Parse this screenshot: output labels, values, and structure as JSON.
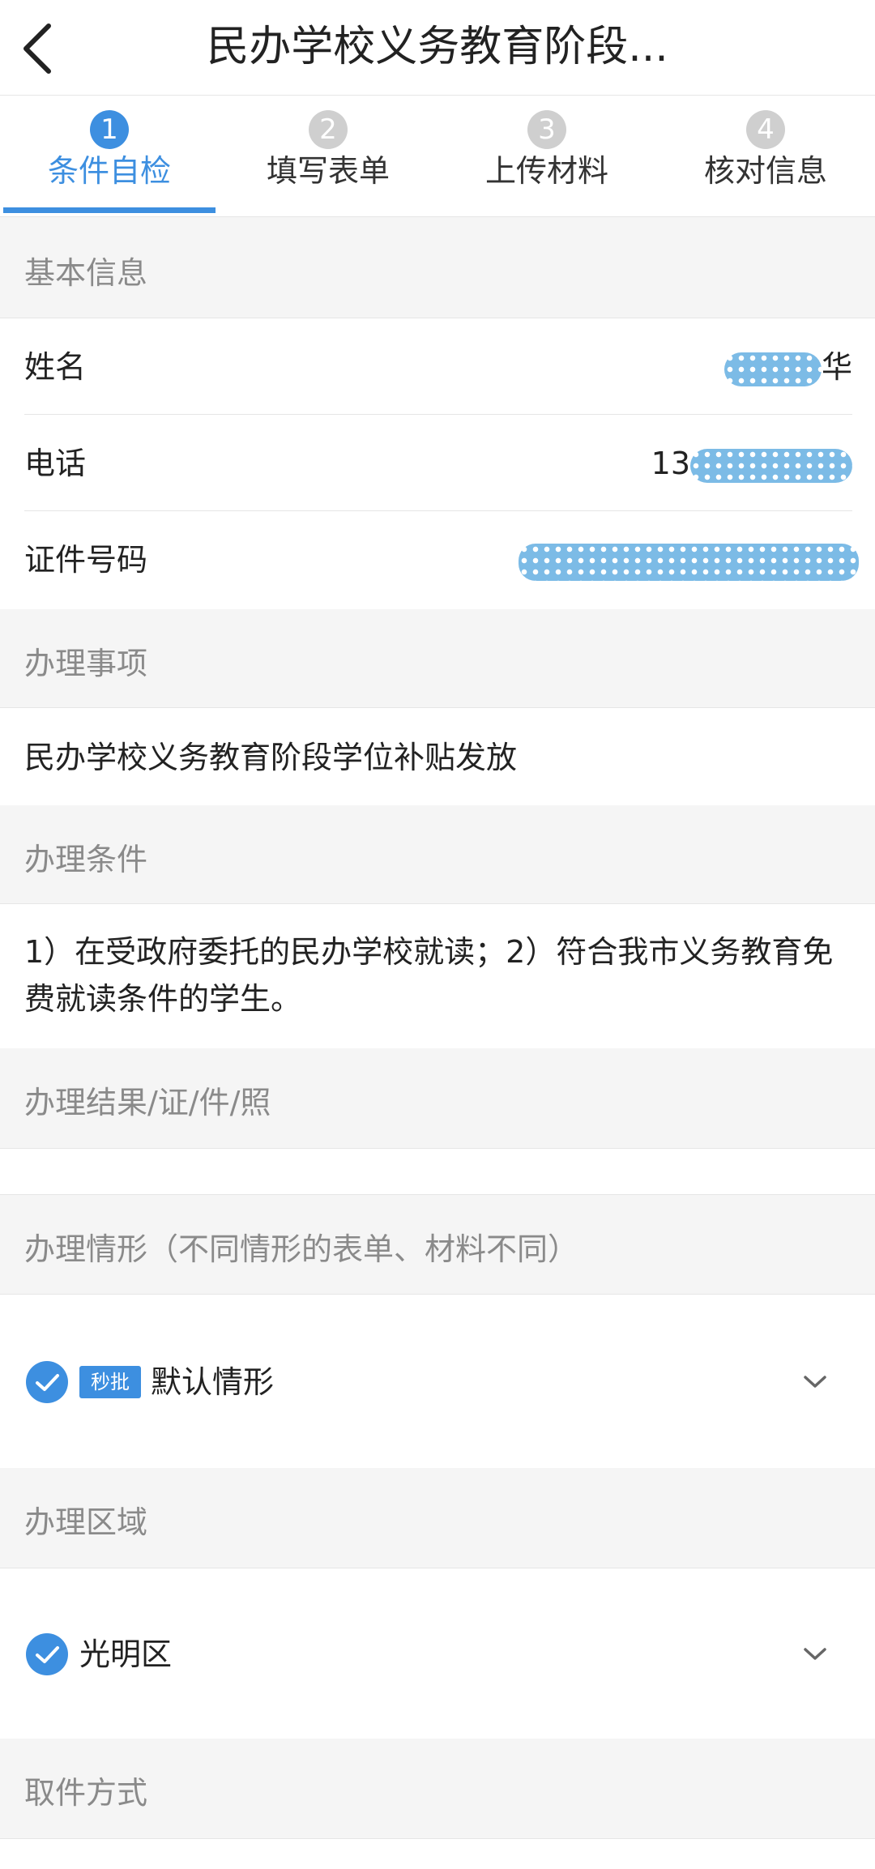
{
  "nav": {
    "title": "民办学校义务教育阶段..."
  },
  "steps": [
    {
      "num": "1",
      "label": "条件自检"
    },
    {
      "num": "2",
      "label": "填写表单"
    },
    {
      "num": "3",
      "label": "上传材料"
    },
    {
      "num": "4",
      "label": "核对信息"
    }
  ],
  "active_step": 1,
  "basic_info": {
    "heading": "基本信息",
    "name_label": "姓名",
    "name_visible": "华",
    "phone_label": "电话",
    "phone_visible": "13",
    "id_label": "证件号码"
  },
  "matter": {
    "heading": "办理事项",
    "value": "民办学校义务教育阶段学位补贴发放"
  },
  "conditions": {
    "heading": "办理条件",
    "value": "1）在受政府委托的民办学校就读；2）符合我市义务教育免费就读条件的学生。"
  },
  "result": {
    "heading": "办理结果/证/件/照",
    "value": ""
  },
  "situation": {
    "heading": "办理情形（不同情形的表单、材料不同）",
    "badge": "秒批",
    "selected": "默认情形"
  },
  "region": {
    "heading": "办理区域",
    "selected": "光明区"
  },
  "pickup": {
    "heading": "取件方式"
  },
  "colors": {
    "accent": "#3d8fe0",
    "mask": "#7cbbe6",
    "section_bg": "#f5f5f5",
    "muted_text": "#8a8a8a"
  },
  "icons": {
    "back": "chevron-left-icon",
    "check": "check-circle-icon",
    "expand": "chevron-down-icon"
  }
}
